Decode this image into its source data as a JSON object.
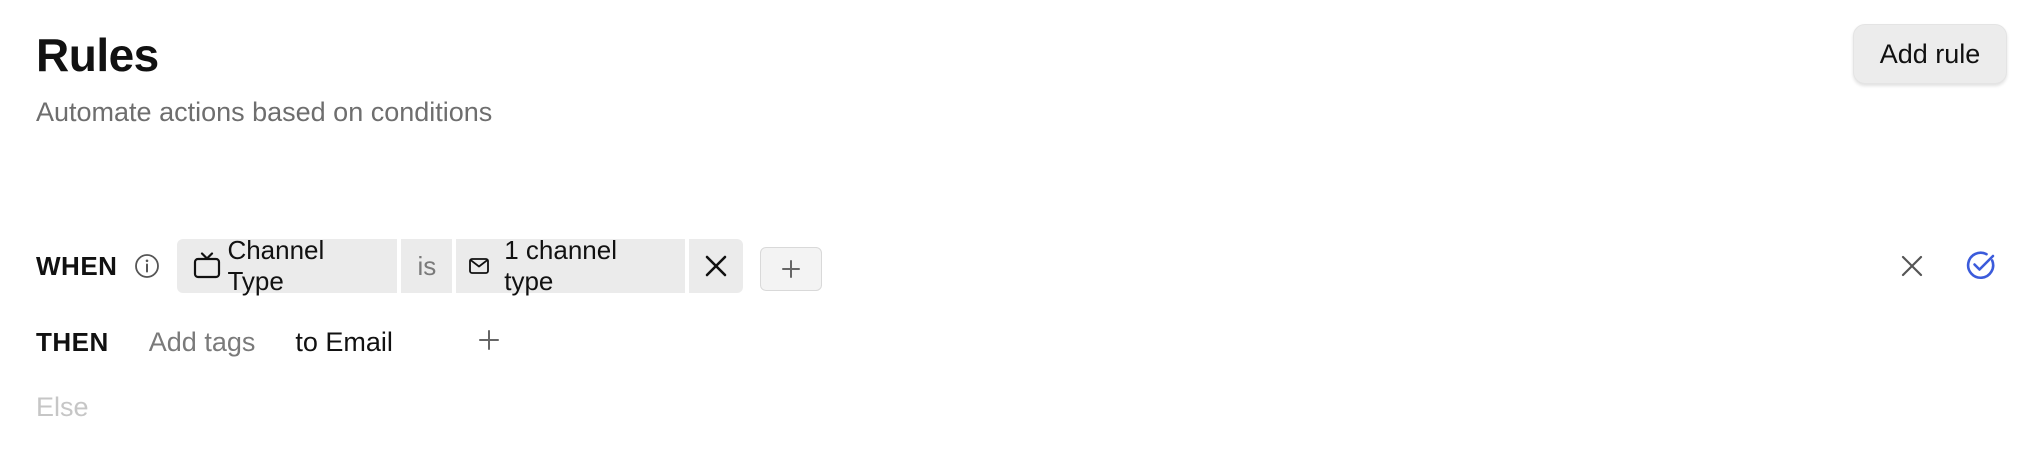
{
  "header": {
    "title": "Rules",
    "subtitle": "Automate actions based on conditions",
    "add_rule_label": "Add rule"
  },
  "rule": {
    "when_label": "WHEN",
    "condition": {
      "field_icon": "tv-icon",
      "field": "Channel Type",
      "operator": "is",
      "value_icon": "mail-icon",
      "value": "1 channel type"
    },
    "then_label": "THEN",
    "then_action_placeholder": "Add tags",
    "then_target": "to Email",
    "else_label": "Else"
  },
  "colors": {
    "confirm_accent": "#3b5bdb",
    "chip_background": "#ebebeb",
    "muted_text": "#7a7a7a"
  }
}
